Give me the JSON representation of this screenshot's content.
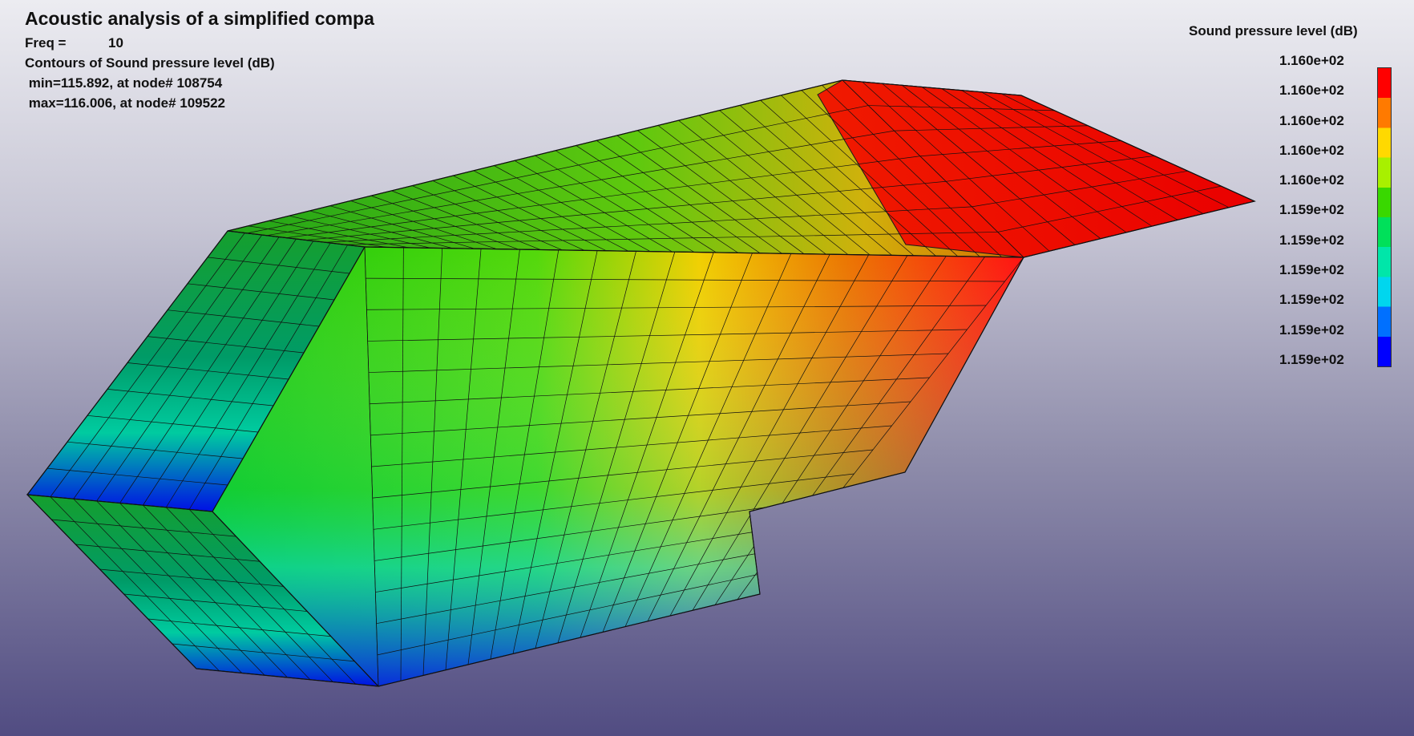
{
  "window": {
    "title": "Acoustic analysis of a simplified compa",
    "freq_label": "Freq =",
    "freq_value": "10",
    "contour_title": "Contours of Sound pressure level (dB)",
    "min_line": " min=115.892, at node# 108754",
    "max_line": " max=116.006, at node# 109522"
  },
  "legend": {
    "title": "Sound pressure level (dB)",
    "labels": [
      "1.160e+02",
      "1.160e+02",
      "1.160e+02",
      "1.160e+02",
      "1.160e+02",
      "1.159e+02",
      "1.159e+02",
      "1.159e+02",
      "1.159e+02",
      "1.159e+02",
      "1.159e+02"
    ],
    "colors": [
      "#ff0000",
      "#ff7a00",
      "#ffd900",
      "#a8f000",
      "#39d800",
      "#00e05a",
      "#00e6a9",
      "#00d6ee",
      "#0070ff",
      "#0000ff"
    ]
  }
}
